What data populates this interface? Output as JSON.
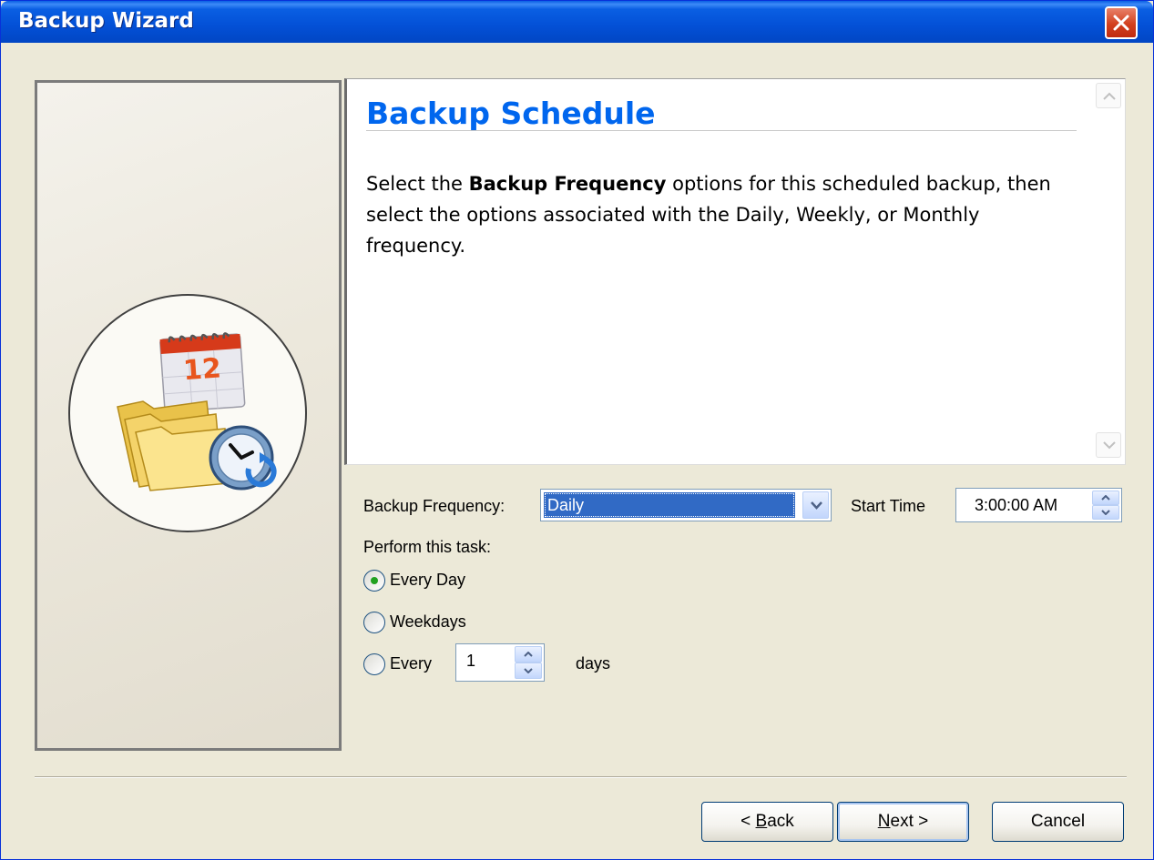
{
  "window": {
    "title": "Backup Wizard"
  },
  "content": {
    "heading": "Backup Schedule",
    "desc_pre": "Select the ",
    "desc_bold": "Backup Frequency",
    "desc_post": " options for this scheduled backup, then select the options associated with the Daily, Weekly, or Monthly frequency."
  },
  "form": {
    "frequency_label": "Backup Frequency:",
    "frequency_value": "Daily",
    "start_time_label": "Start Time",
    "start_time_value": "3:00:00 AM",
    "perform_label": "Perform this task:",
    "options": [
      {
        "label": "Every Day",
        "selected": true
      },
      {
        "label": "Weekdays",
        "selected": false
      },
      {
        "label": "Every",
        "selected": false
      }
    ],
    "every_value": "1",
    "days_label": "days"
  },
  "buttons": {
    "back": {
      "pre": "< ",
      "key": "B",
      "rest": "ack"
    },
    "next": {
      "key": "N",
      "rest": "ext >"
    },
    "cancel": "Cancel"
  },
  "icons": {
    "close": "close-x-icon",
    "calendar_day": "12",
    "illustration": "calendar-folder-clock-icon"
  },
  "colors": {
    "title_gradient": "#0350d6",
    "heading": "#0066ee",
    "selection": "#316ac5",
    "close_button": "#d2401e",
    "radio_dot": "#21a121"
  }
}
